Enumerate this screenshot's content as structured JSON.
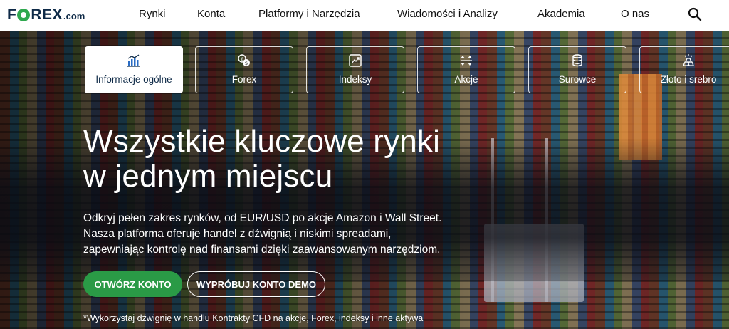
{
  "header": {
    "logo": {
      "text_a": "F",
      "text_b": "REX",
      "suffix": ".com"
    },
    "nav": [
      "Rynki",
      "Konta",
      "Platformy i Narzędzia",
      "Wiadomości i Analizy",
      "Akademia",
      "O nas"
    ],
    "search_icon": "search-icon"
  },
  "tabs": [
    {
      "label": "Informacje ogólne",
      "icon": "chart-icon",
      "active": true
    },
    {
      "label": "Forex",
      "icon": "currency-exchange-icon",
      "active": false
    },
    {
      "label": "Indeksy",
      "icon": "trend-up-icon",
      "active": false
    },
    {
      "label": "Akcje",
      "icon": "arrows-updown-icon",
      "active": false
    },
    {
      "label": "Surowce",
      "icon": "barrel-icon",
      "active": false
    },
    {
      "label": "Złoto i srebro",
      "icon": "gold-bars-icon",
      "active": false
    }
  ],
  "hero": {
    "headline_line1": "Wszystkie kluczowe rynki",
    "headline_line2": "w jednym miejscu",
    "desc_line1": "Odkryj pełen zakres rynków, od EUR/USD po akcje Amazon i Wall Street.",
    "desc_line2": "Nasza platforma oferuje handel z dźwignią i niskimi spreadami,",
    "desc_line3": "zapewniając kontrolę nad finansami dzięki zaawansowanym narzędziom.",
    "primary_button": "OTWÓRZ KONTO",
    "secondary_button": "WYPRÓBUJ KONTO DEMO",
    "footnote": "*Wykorzystaj dźwignię w handlu Kontrakty CFD na akcje, Forex, indeksy i inne aktywa"
  },
  "colors": {
    "brand_navy": "#0e2a47",
    "brand_green": "#2fa84f",
    "button_green": "#2a9a46"
  }
}
